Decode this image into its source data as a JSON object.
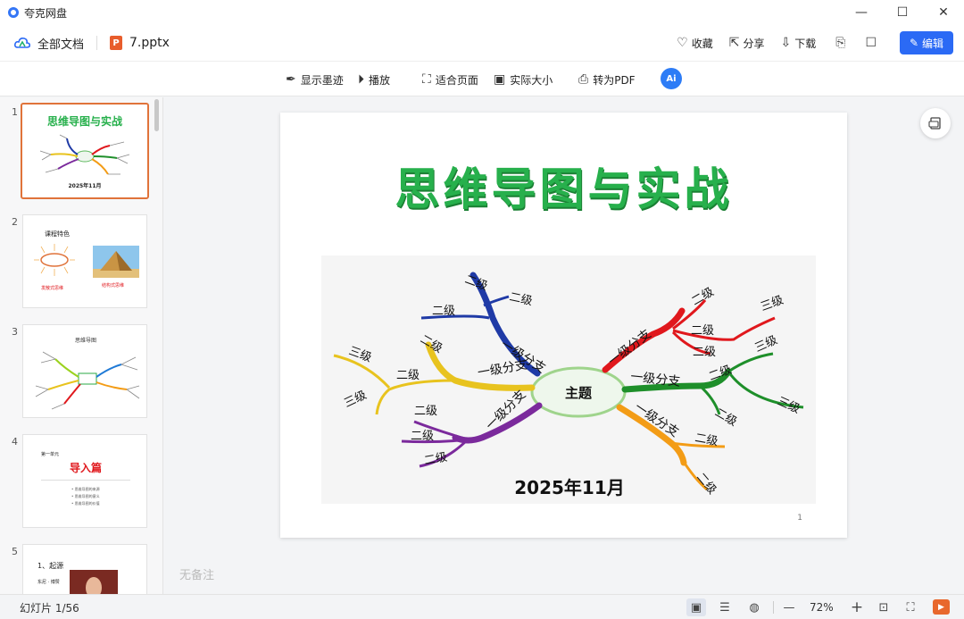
{
  "window": {
    "app_title": "夸克网盘",
    "minimize": "—",
    "maximize": "☐",
    "close": "✕"
  },
  "topbar": {
    "all_docs": "全部文档",
    "file_name": "7.pptx",
    "ppt_badge": "P",
    "favorite": "收藏",
    "share": "分享",
    "download": "下载",
    "edit": "编辑"
  },
  "toolbar": {
    "show_ink": "显示墨迹",
    "play": "播放",
    "fit_page": "适合页面",
    "actual_size": "实际大小",
    "to_pdf": "转为PDF",
    "ai": "Ai"
  },
  "thumbnails": [
    {
      "num": "1",
      "title": "思维导图与实战",
      "date": "2025年11月"
    },
    {
      "num": "2",
      "title": "课程特色",
      "left_label": "发散式思维",
      "right_label": "结构式思维"
    },
    {
      "num": "3",
      "title": "思维导图"
    },
    {
      "num": "4",
      "unit": "第一单元",
      "title": "导入篇",
      "bullets": [
        "• 思维导图的来源",
        "• 思维导图的意义",
        "• 思维导图的价值"
      ]
    },
    {
      "num": "5",
      "title": "1、起源",
      "name_label": "东尼 · 博赞"
    }
  ],
  "slide": {
    "title": "思维导图与实战",
    "center": "主题",
    "level1": "一级分支",
    "level2": "二级",
    "level3": "三级",
    "date": "2025年11月",
    "page_number": "1"
  },
  "notes_placeholder": "无备注",
  "status": {
    "slide_counter": "幻灯片 1/56",
    "zoom": "72%",
    "zoom_out": "—",
    "zoom_in": "+"
  },
  "colors": {
    "accent": "#2b6af5",
    "ppt_orange": "#e85d2c",
    "title_green": "#27b04c",
    "branch_blue": "#1f3aa6",
    "branch_red": "#e0181d",
    "branch_green": "#1e8f2a",
    "branch_orange": "#f39c16",
    "branch_yellow": "#e8c31e",
    "branch_purple": "#7b2a9c"
  }
}
